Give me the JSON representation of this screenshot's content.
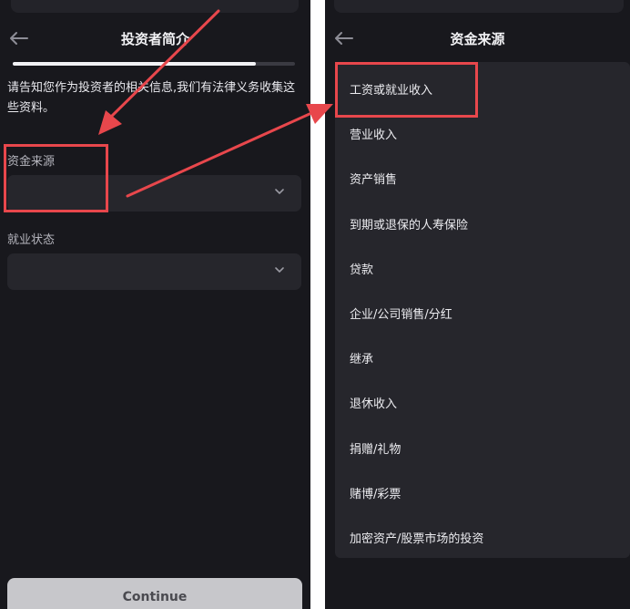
{
  "left_screen": {
    "title": "投资者简介",
    "progress_fraction": 0.86,
    "notice": "请告知您作为投资者的相关信息,我们有法律义务收集这些资料。",
    "fund_source_label": "资金来源",
    "fund_source_value": "",
    "employment_label": "就业状态",
    "employment_value": "",
    "continue_label": "Continue"
  },
  "right_screen": {
    "title": "资金来源",
    "options": [
      "工资或就业收入",
      "营业收入",
      "资产销售",
      "到期或退保的人寿保险",
      "贷款",
      "企业/公司销售/分红",
      "继承",
      "退休收入",
      "捐赠/礼物",
      "赌博/彩票",
      "加密资产/股票市场的投资"
    ]
  },
  "colors": {
    "background": "#18181d",
    "field": "#26262c",
    "annotation": "#e8474c",
    "button": "#c7c7cb"
  },
  "icons": {
    "back": "arrow-left-icon",
    "dropdown": "chevron-down-icon"
  }
}
